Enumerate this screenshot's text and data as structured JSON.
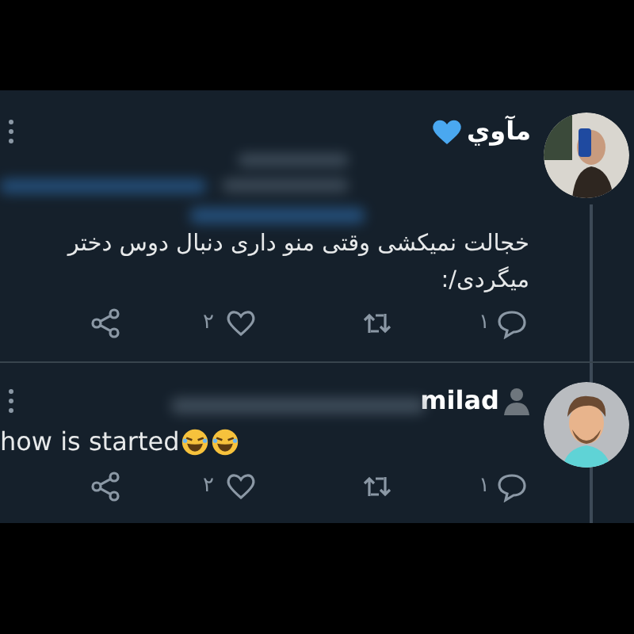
{
  "tweets": [
    {
      "author": "مآوي",
      "body": "خجالت نمیکشی وقتی منو داری دنبال دوس دختر میگردی/:",
      "replies": "۱",
      "likes": "۲"
    },
    {
      "author": "milad",
      "body": "how is started",
      "replies": "۱",
      "likes": "۲"
    }
  ]
}
